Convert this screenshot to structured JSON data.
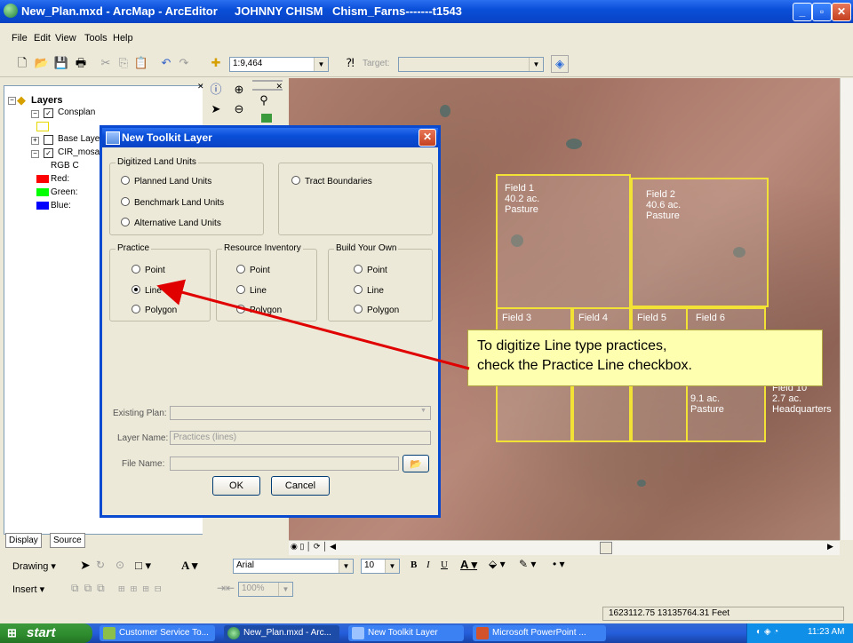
{
  "window": {
    "title": "New_Plan.mxd - ArcMap - ArcEditor",
    "user": "JOHNNY CHISM",
    "doc": "Chism_Farns-------t1543",
    "min": "_",
    "max": "▫",
    "close": "✕"
  },
  "menu": [
    "File",
    "Edit",
    "View",
    "Tools",
    "Help"
  ],
  "toolbar": {
    "scale": "1:9,464",
    "target_label": "Target:"
  },
  "toc": {
    "root": "Layers",
    "layers": [
      "Consplan",
      "Base Layers",
      "CIR_mosaic"
    ],
    "rgb_label": "RGB C",
    "bands": [
      "Red:",
      "Green:",
      "Blue:"
    ],
    "band_colors": [
      "#ff0000",
      "#00ff00",
      "#0000ff"
    ],
    "tabs": [
      "Display",
      "Source"
    ]
  },
  "dialog": {
    "title": "New Toolkit Layer",
    "group_dlu": "Digitized Land Units",
    "dlu_options": [
      "Planned Land Units",
      "Benchmark Land Units",
      "Alternative Land Units"
    ],
    "tract": "Tract Boundaries",
    "practice": {
      "title": "Practice",
      "options": [
        "Point",
        "Line",
        "Polygon"
      ],
      "selected": "Line"
    },
    "resource": {
      "title": "Resource Inventory",
      "options": [
        "Point",
        "Line",
        "Polygon"
      ]
    },
    "build": {
      "title": "Build Your Own",
      "options": [
        "Point",
        "Line",
        "Polygon"
      ]
    },
    "existing_plan_label": "Existing Plan:",
    "layer_name_label": "Layer Name:",
    "layer_name_value": "Practices (lines)",
    "file_name_label": "File Name:",
    "ok": "OK",
    "cancel": "Cancel"
  },
  "callout": {
    "line1": "To digitize Line type practices,",
    "line2": "check the Practice Line checkbox."
  },
  "map": {
    "fields": [
      {
        "name": "Field 1",
        "area": "40.2 ac.",
        "use": "Pasture"
      },
      {
        "name": "Field 2",
        "area": "40.6 ac.",
        "use": "Pasture"
      },
      {
        "name": "Field 3",
        "area": "",
        "use": ""
      },
      {
        "name": "Field 4",
        "area": "",
        "use": ""
      },
      {
        "name": "Field 5",
        "area": "",
        "use": ""
      },
      {
        "name": "Field 6",
        "area": "9.1 ac.",
        "use": "Pasture"
      },
      {
        "name": "Field 10",
        "area": "2.7 ac.",
        "use": "Headquarters"
      }
    ]
  },
  "drawing": {
    "label": "Drawing ▾",
    "font": "Arial",
    "size": "10",
    "insert": "Insert ▾",
    "zoom": "100%"
  },
  "status": {
    "coords": "1623112.75  13135764.31 Feet"
  },
  "taskbar": {
    "start": "start",
    "tasks": [
      "Customer Service To...",
      "New_Plan.mxd - Arc...",
      "New Toolkit Layer",
      "Microsoft PowerPoint ..."
    ],
    "clock": "11:23 AM"
  }
}
